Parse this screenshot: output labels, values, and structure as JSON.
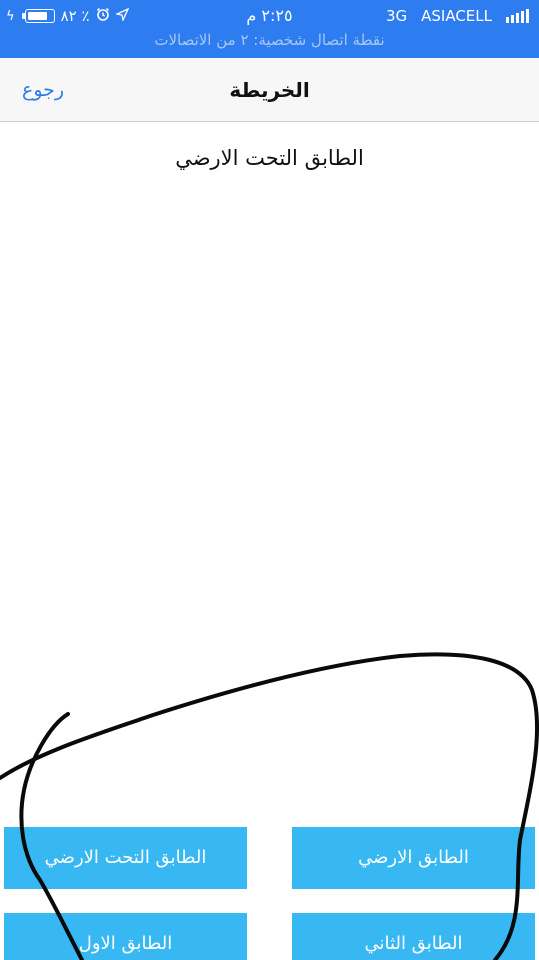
{
  "status_bar": {
    "battery_percent": "٨٢ ٪",
    "battery_level": 0.82,
    "time": "٢:٢٥ م",
    "network": "3G",
    "carrier": "ASIACELL",
    "hotspot_text": "نقطة اتصال شخصية: ٢ من الاتصالات",
    "icons": [
      "charging-bolt-icon",
      "battery-icon",
      "alarm-icon",
      "location-arrow-icon",
      "signal-bars-icon"
    ],
    "color": "#2d7cf0"
  },
  "navbar": {
    "title": "الخريطة",
    "back_label": "رجوع",
    "accent_color": "#2b7de9"
  },
  "content": {
    "floor_title": "الطابق التحت الارضي"
  },
  "floor_buttons": [
    {
      "label": "الطابق التحت الارضي"
    },
    {
      "label": "الطابق الارضي"
    },
    {
      "label": "الطابق الاول"
    },
    {
      "label": "الطابق الثاني"
    }
  ],
  "button_color": "#37b8f3"
}
